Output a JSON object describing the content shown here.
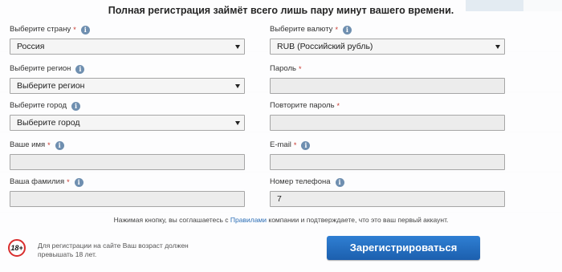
{
  "title": "Полная регистрация займёт всего лишь пару минут вашего времени.",
  "left": [
    {
      "label": "Выберите страну",
      "required": "*",
      "value": "Россия",
      "type": "select"
    },
    {
      "label": "Выберите регион",
      "required": "",
      "value": "Выберите регион",
      "type": "select"
    },
    {
      "label": "Выберите город",
      "required": "",
      "value": "Выберите город",
      "type": "select"
    },
    {
      "label": "Ваше имя",
      "required": "*",
      "value": "",
      "type": "input"
    },
    {
      "label": "Ваша фамилия",
      "required": "*",
      "value": "",
      "type": "input"
    }
  ],
  "right": [
    {
      "label": "Выберите валюту",
      "required": "*",
      "value": "RUB (Российский рубль)",
      "type": "select"
    },
    {
      "label": "Пароль",
      "required": "*",
      "value": "",
      "type": "input"
    },
    {
      "label": "Повторите пароль",
      "required": "*",
      "value": "",
      "type": "input"
    },
    {
      "label": "E-mail",
      "required": "*",
      "value": "",
      "type": "input"
    },
    {
      "label": "Номер телефона",
      "required": "",
      "value": "7",
      "type": "input"
    }
  ],
  "info_glyph": "i",
  "agreement": {
    "before": "Нажимая кнопку, вы соглашаетесь с ",
    "link": "Правилами",
    "after": " компании и подтверждаете, что это ваш первый аккаунт."
  },
  "age": {
    "badge": "18+",
    "text": "Для регистрации на сайте Ваш возраст должен превышать 18 лет."
  },
  "register_label": "Зарегистрироваться",
  "colors": {
    "accent": "#1c5fae",
    "required": "#c8352b",
    "link": "#2d6fb6"
  }
}
